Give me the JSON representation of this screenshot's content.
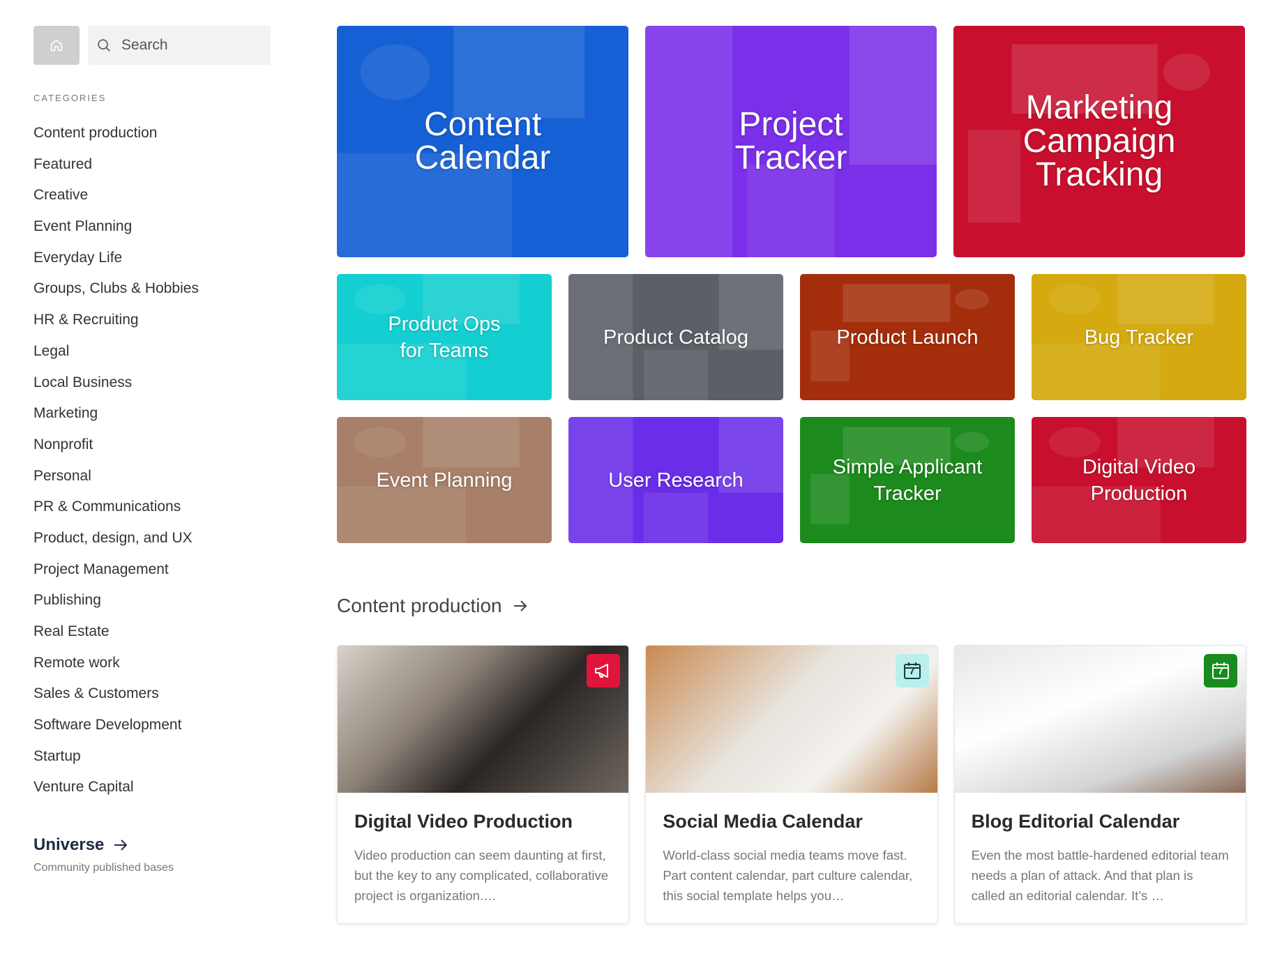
{
  "search": {
    "placeholder": "Search"
  },
  "sidebar": {
    "heading": "CATEGORIES",
    "items": [
      "Content production",
      "Featured",
      "Creative",
      "Event Planning",
      "Everyday Life",
      "Groups, Clubs & Hobbies",
      "HR & Recruiting",
      "Legal",
      "Local Business",
      "Marketing",
      "Nonprofit",
      "Personal",
      "PR & Communications",
      "Product, design, and UX",
      "Project Management",
      "Publishing",
      "Real Estate",
      "Remote work",
      "Sales & Customers",
      "Software Development",
      "Startup",
      "Venture Capital"
    ],
    "universe": {
      "title": "Universe",
      "subtitle": "Community published bases"
    }
  },
  "featured": {
    "big": [
      {
        "title": "Content Calendar",
        "color": "#1560d4"
      },
      {
        "title": "Project Tracker",
        "color": "#7a2fe8"
      },
      {
        "title": "Marketing Campaign Tracking",
        "color": "#c8102e"
      }
    ],
    "row2": [
      {
        "title": "Product Ops for Teams",
        "color": "#13cfd1"
      },
      {
        "title": "Product Catalog",
        "color": "#5b5f66"
      },
      {
        "title": "Product Launch",
        "color": "#a42e0c"
      },
      {
        "title": "Bug Tracker",
        "color": "#d4aa10"
      }
    ],
    "row3": [
      {
        "title": "Event Planning",
        "color": "#a8806a"
      },
      {
        "title": "User Research",
        "color": "#6a2ee8"
      },
      {
        "title": "Simple Applicant Tracker",
        "color": "#1d8a1d"
      },
      {
        "title": "Digital Video Production",
        "color": "#c8102e"
      }
    ]
  },
  "section": {
    "title": "Content production"
  },
  "templates": [
    {
      "title": "Digital Video Production",
      "description": "Video production can seem daunting at first, but the key to any complicated, collaborative project is organization.…",
      "badge_icon": "megaphone-icon",
      "badge_color": "#e0143c"
    },
    {
      "title": "Social Media Calendar",
      "description": "World-class social media teams move fast. Part content calendar, part culture calendar, this social template helps you…",
      "badge_icon": "calendar-icon",
      "badge_color": "#b9f0ee",
      "badge_number": "7"
    },
    {
      "title": "Blog Editorial Calendar",
      "description": "Even the most battle-hardened editorial team needs a plan of attack. And that plan is called an editorial calendar. It’s …",
      "badge_icon": "calendar-icon",
      "badge_color": "#188c1c",
      "badge_number": "7"
    }
  ]
}
